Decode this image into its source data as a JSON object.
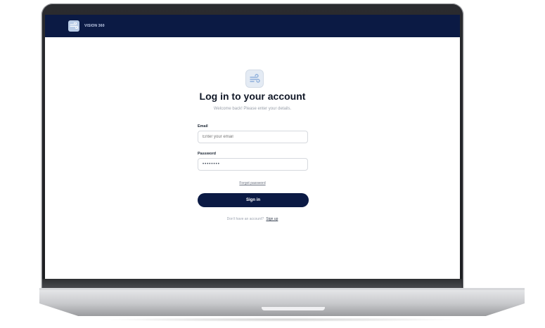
{
  "app": {
    "brand": "VISION 360",
    "brand_logo_icon": "wind-icon",
    "hero_icon": "wind-icon"
  },
  "login": {
    "title": "Log in to your account",
    "subtitle": "Welcome back! Please enter your details.",
    "email_label": "Email",
    "email_placeholder": "Enter your email",
    "password_label": "Password",
    "password_value": "••••••••",
    "forgot_link": "Forgot password",
    "signin_button": "Sign in",
    "signup_prompt": "Don't have an account?",
    "signup_link": "Sign up"
  },
  "colors": {
    "navy": "#0b1a44",
    "accent_icon": "#9db8dd"
  }
}
